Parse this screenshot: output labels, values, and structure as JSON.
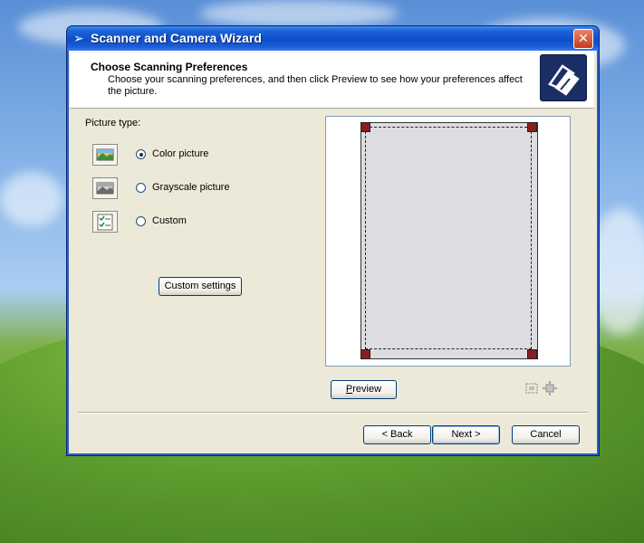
{
  "window": {
    "title": "Scanner and Camera Wizard"
  },
  "header": {
    "title": "Choose Scanning Preferences",
    "description": "Choose your scanning preferences, and then click Preview to see how your preferences affect the picture."
  },
  "picture_type": {
    "label": "Picture type:",
    "options": [
      {
        "label": "Color picture",
        "selected": true,
        "icon": "color-picture-icon"
      },
      {
        "label": "Grayscale picture",
        "selected": false,
        "icon": "grayscale-picture-icon"
      },
      {
        "label": "Custom",
        "selected": false,
        "icon": "custom-settings-icon"
      }
    ]
  },
  "buttons": {
    "custom_settings": "Custom settings",
    "preview": "Preview",
    "back": "< Back",
    "next": "Next >",
    "cancel": "Cancel"
  },
  "colors": {
    "titlebar": "#0c4fcb",
    "dialog_bg": "#ece9d8",
    "crop_handle": "#8b1e1e"
  }
}
